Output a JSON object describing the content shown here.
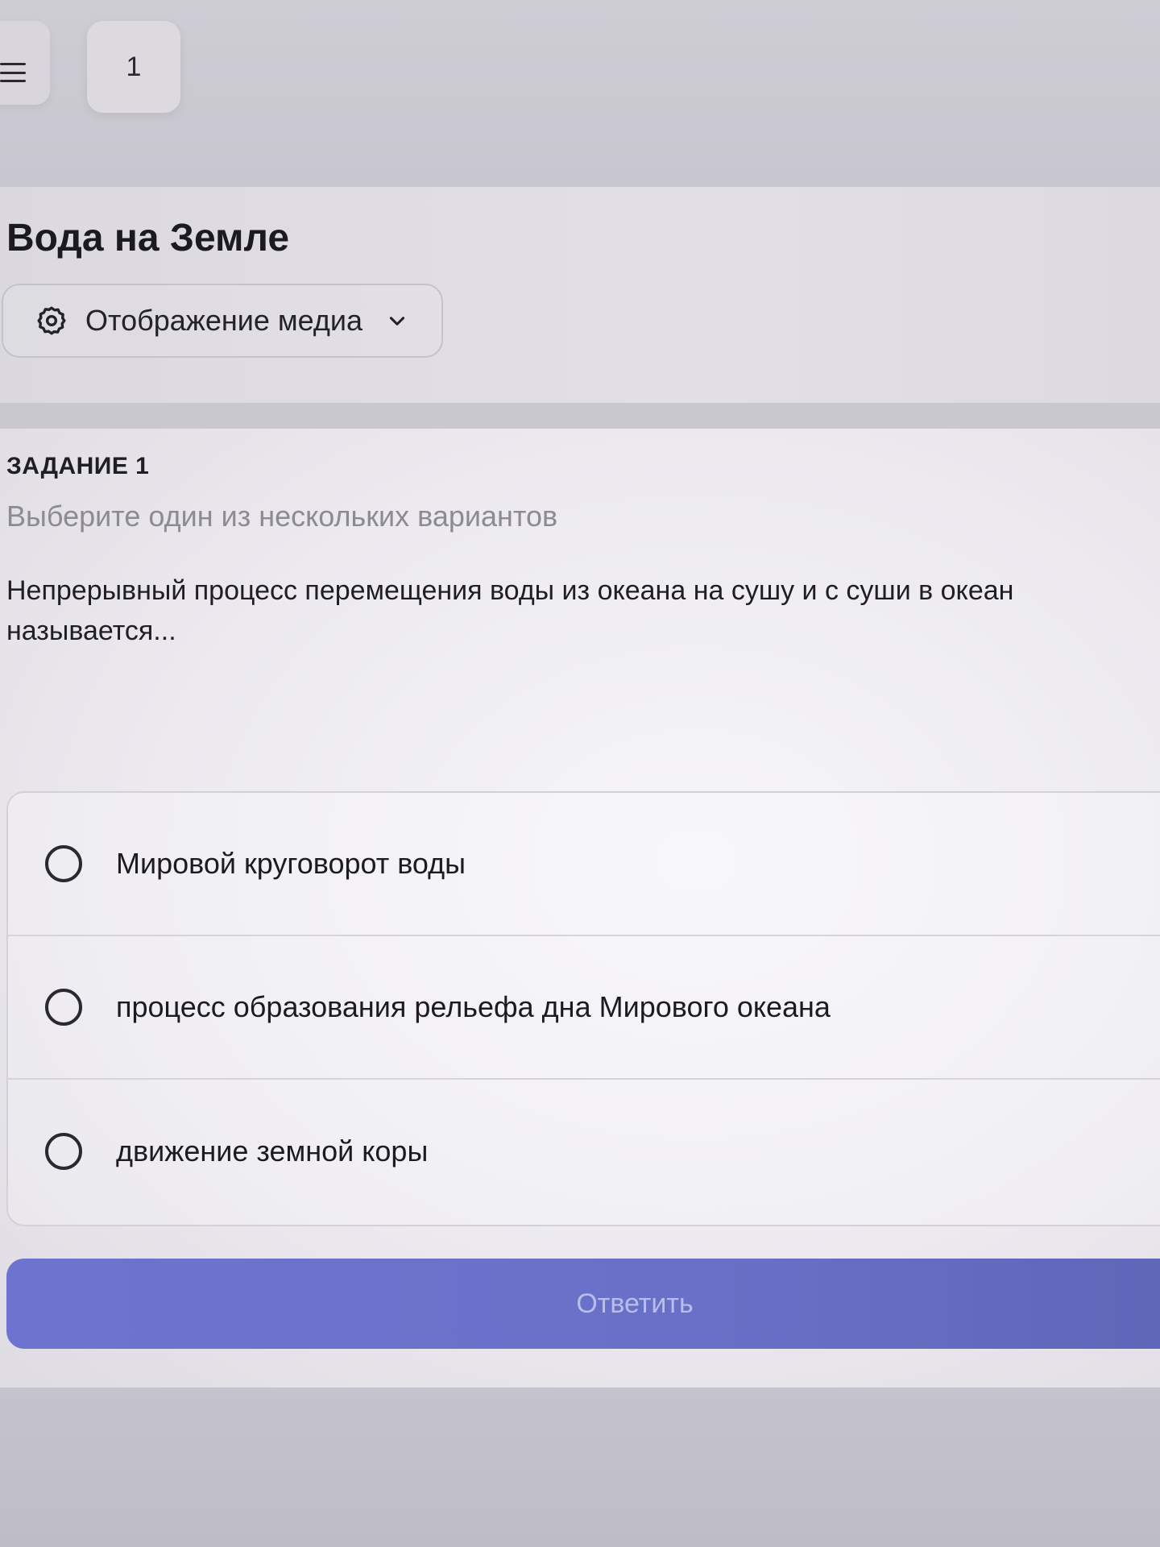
{
  "topbar": {
    "menu_icon": "hamburger-icon",
    "page_number": "1"
  },
  "header": {
    "title": "Вода на Земле",
    "media_toggle": {
      "icon": "gear-icon",
      "label": "Отображение медиа",
      "chevron_icon": "chevron-down-icon"
    }
  },
  "task": {
    "label": "ЗАДАНИЕ 1",
    "hint": "Выберите один из нескольких вариантов",
    "question": "Непрерывный процесс перемещения воды из океана на сушу и с суши в океан называется...",
    "options": [
      {
        "text": "Мировой круговорот воды"
      },
      {
        "text": "процесс образования рельефа дна Мирового океана"
      },
      {
        "text": "движение земной коры"
      }
    ],
    "submit_label": "Ответить"
  },
  "colors": {
    "accent_button": "#6d74cf",
    "accent_button_text": "#b9bde9",
    "card_background": "#eceaef"
  }
}
